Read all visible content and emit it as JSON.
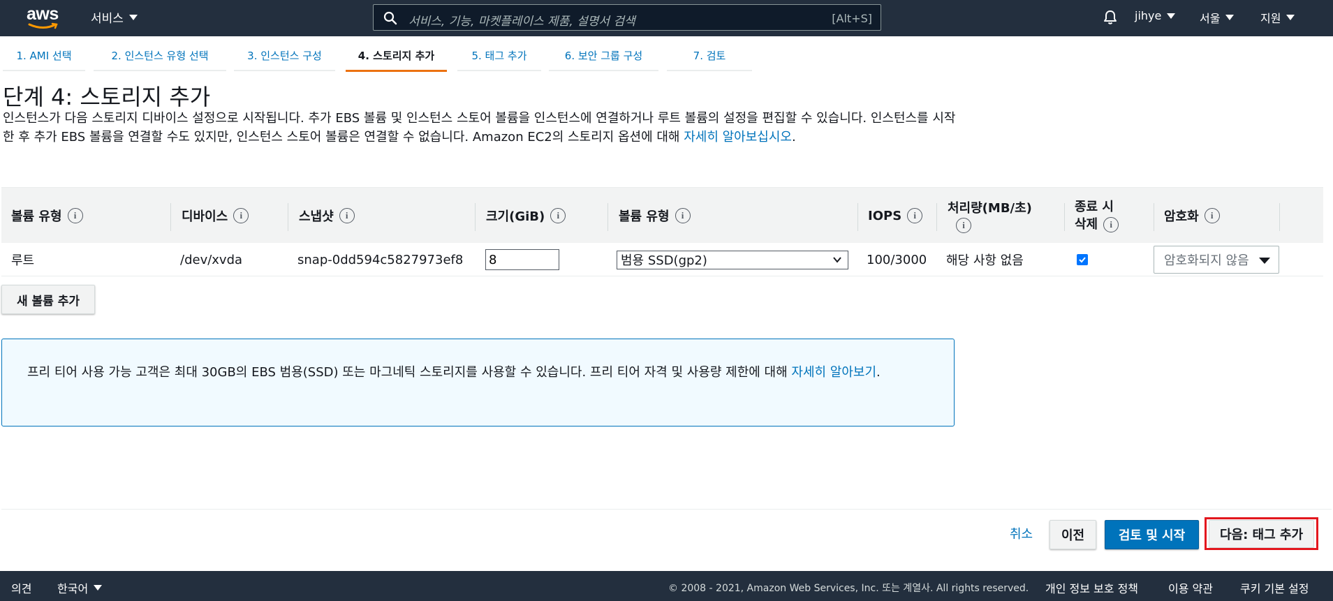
{
  "topnav": {
    "logo": "aws",
    "services_label": "서비스",
    "search_placeholder": "서비스, 기능, 마켓플레이스 제품, 설명서 검색",
    "search_shortcut": "[Alt+S]",
    "user": "jihye",
    "region": "서울",
    "support": "지원"
  },
  "steps": [
    {
      "label": "1. AMI 선택"
    },
    {
      "label": "2. 인스턴스 유형 선택"
    },
    {
      "label": "3. 인스턴스 구성"
    },
    {
      "label": "4. 스토리지 추가"
    },
    {
      "label": "5. 태그 추가"
    },
    {
      "label": "6. 보안 그룹 구성"
    },
    {
      "label": "7. 검토"
    }
  ],
  "active_step": 4,
  "page": {
    "title": "단계 4: 스토리지 추가",
    "description": "인스턴스가 다음 스토리지 디바이스 설정으로 시작됩니다. 추가 EBS 볼륨 및 인스턴스 스토어 볼륨을 인스턴스에 연결하거나 루트 볼륨의 설정을 편집할 수 있습니다. 인스턴스를 시작한 후 추가 EBS 볼륨을 연결할 수도 있지만, 인스턴스 스토어 볼륨은 연결할 수 없습니다. Amazon EC2의 스토리지 옵션에 대해 ",
    "description_link": "자세히 알아보십시오",
    "description_end": "."
  },
  "table": {
    "headers": {
      "volume_kind": "볼륨 유형",
      "device": "디바이스",
      "snapshot": "스냅샷",
      "size": "크기(GiB)",
      "volume_type": "볼륨 유형",
      "iops": "IOPS",
      "throughput_1": "처리량(MB/초)",
      "delete_1": "종료 시",
      "delete_2": "삭제",
      "encryption": "암호화"
    },
    "row": {
      "volume_kind": "루트",
      "device": "/dev/xvda",
      "snapshot": "snap-0dd594c5827973ef8",
      "size": "8",
      "volume_type": "범용 SSD(gp2)",
      "iops": "100/3000",
      "throughput": "해당 사항 없음",
      "delete_on_termination": true,
      "encryption": "암호화되지 않음"
    }
  },
  "add_volume_label": "새 볼륨 추가",
  "infobox": {
    "text": "프리 티어 사용 가능 고객은 최대 30GB의 EBS 범용(SSD) 또는 마그네틱 스토리지를 사용할 수 있습니다. 프리 티어 자격 및 사용량 제한에 대해 ",
    "link": "자세히 알아보기",
    "end": "."
  },
  "actions": {
    "cancel": "취소",
    "previous": "이전",
    "review_launch": "검토 및 시작",
    "next": "다음: 태그 추가"
  },
  "bottombar": {
    "feedback": "의견",
    "language": "한국어",
    "copyright": "© 2008 - 2021, Amazon Web Services, Inc. 또는 계열사. All rights reserved.",
    "privacy": "개인 정보 보호 정책",
    "terms": "이용 약관",
    "cookies": "쿠키 기본 설정"
  },
  "colors": {
    "nav_bg": "#232f3e",
    "link": "#0073bb",
    "active_step": "#ec7211",
    "primary_button": "#0073bb",
    "highlight": "#e3171e"
  }
}
